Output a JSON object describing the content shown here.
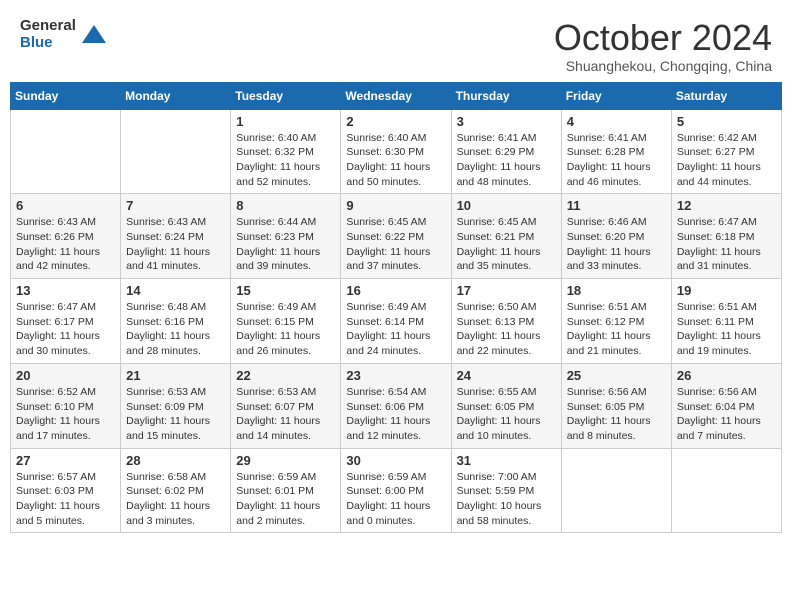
{
  "header": {
    "logo_general": "General",
    "logo_blue": "Blue",
    "month_title": "October 2024",
    "location": "Shuanghekou, Chongqing, China"
  },
  "weekdays": [
    "Sunday",
    "Monday",
    "Tuesday",
    "Wednesday",
    "Thursday",
    "Friday",
    "Saturday"
  ],
  "weeks": [
    [
      {
        "day": "",
        "sunrise": "",
        "sunset": "",
        "daylight": ""
      },
      {
        "day": "",
        "sunrise": "",
        "sunset": "",
        "daylight": ""
      },
      {
        "day": "1",
        "sunrise": "Sunrise: 6:40 AM",
        "sunset": "Sunset: 6:32 PM",
        "daylight": "Daylight: 11 hours and 52 minutes."
      },
      {
        "day": "2",
        "sunrise": "Sunrise: 6:40 AM",
        "sunset": "Sunset: 6:30 PM",
        "daylight": "Daylight: 11 hours and 50 minutes."
      },
      {
        "day": "3",
        "sunrise": "Sunrise: 6:41 AM",
        "sunset": "Sunset: 6:29 PM",
        "daylight": "Daylight: 11 hours and 48 minutes."
      },
      {
        "day": "4",
        "sunrise": "Sunrise: 6:41 AM",
        "sunset": "Sunset: 6:28 PM",
        "daylight": "Daylight: 11 hours and 46 minutes."
      },
      {
        "day": "5",
        "sunrise": "Sunrise: 6:42 AM",
        "sunset": "Sunset: 6:27 PM",
        "daylight": "Daylight: 11 hours and 44 minutes."
      }
    ],
    [
      {
        "day": "6",
        "sunrise": "Sunrise: 6:43 AM",
        "sunset": "Sunset: 6:26 PM",
        "daylight": "Daylight: 11 hours and 42 minutes."
      },
      {
        "day": "7",
        "sunrise": "Sunrise: 6:43 AM",
        "sunset": "Sunset: 6:24 PM",
        "daylight": "Daylight: 11 hours and 41 minutes."
      },
      {
        "day": "8",
        "sunrise": "Sunrise: 6:44 AM",
        "sunset": "Sunset: 6:23 PM",
        "daylight": "Daylight: 11 hours and 39 minutes."
      },
      {
        "day": "9",
        "sunrise": "Sunrise: 6:45 AM",
        "sunset": "Sunset: 6:22 PM",
        "daylight": "Daylight: 11 hours and 37 minutes."
      },
      {
        "day": "10",
        "sunrise": "Sunrise: 6:45 AM",
        "sunset": "Sunset: 6:21 PM",
        "daylight": "Daylight: 11 hours and 35 minutes."
      },
      {
        "day": "11",
        "sunrise": "Sunrise: 6:46 AM",
        "sunset": "Sunset: 6:20 PM",
        "daylight": "Daylight: 11 hours and 33 minutes."
      },
      {
        "day": "12",
        "sunrise": "Sunrise: 6:47 AM",
        "sunset": "Sunset: 6:18 PM",
        "daylight": "Daylight: 11 hours and 31 minutes."
      }
    ],
    [
      {
        "day": "13",
        "sunrise": "Sunrise: 6:47 AM",
        "sunset": "Sunset: 6:17 PM",
        "daylight": "Daylight: 11 hours and 30 minutes."
      },
      {
        "day": "14",
        "sunrise": "Sunrise: 6:48 AM",
        "sunset": "Sunset: 6:16 PM",
        "daylight": "Daylight: 11 hours and 28 minutes."
      },
      {
        "day": "15",
        "sunrise": "Sunrise: 6:49 AM",
        "sunset": "Sunset: 6:15 PM",
        "daylight": "Daylight: 11 hours and 26 minutes."
      },
      {
        "day": "16",
        "sunrise": "Sunrise: 6:49 AM",
        "sunset": "Sunset: 6:14 PM",
        "daylight": "Daylight: 11 hours and 24 minutes."
      },
      {
        "day": "17",
        "sunrise": "Sunrise: 6:50 AM",
        "sunset": "Sunset: 6:13 PM",
        "daylight": "Daylight: 11 hours and 22 minutes."
      },
      {
        "day": "18",
        "sunrise": "Sunrise: 6:51 AM",
        "sunset": "Sunset: 6:12 PM",
        "daylight": "Daylight: 11 hours and 21 minutes."
      },
      {
        "day": "19",
        "sunrise": "Sunrise: 6:51 AM",
        "sunset": "Sunset: 6:11 PM",
        "daylight": "Daylight: 11 hours and 19 minutes."
      }
    ],
    [
      {
        "day": "20",
        "sunrise": "Sunrise: 6:52 AM",
        "sunset": "Sunset: 6:10 PM",
        "daylight": "Daylight: 11 hours and 17 minutes."
      },
      {
        "day": "21",
        "sunrise": "Sunrise: 6:53 AM",
        "sunset": "Sunset: 6:09 PM",
        "daylight": "Daylight: 11 hours and 15 minutes."
      },
      {
        "day": "22",
        "sunrise": "Sunrise: 6:53 AM",
        "sunset": "Sunset: 6:07 PM",
        "daylight": "Daylight: 11 hours and 14 minutes."
      },
      {
        "day": "23",
        "sunrise": "Sunrise: 6:54 AM",
        "sunset": "Sunset: 6:06 PM",
        "daylight": "Daylight: 11 hours and 12 minutes."
      },
      {
        "day": "24",
        "sunrise": "Sunrise: 6:55 AM",
        "sunset": "Sunset: 6:05 PM",
        "daylight": "Daylight: 11 hours and 10 minutes."
      },
      {
        "day": "25",
        "sunrise": "Sunrise: 6:56 AM",
        "sunset": "Sunset: 6:05 PM",
        "daylight": "Daylight: 11 hours and 8 minutes."
      },
      {
        "day": "26",
        "sunrise": "Sunrise: 6:56 AM",
        "sunset": "Sunset: 6:04 PM",
        "daylight": "Daylight: 11 hours and 7 minutes."
      }
    ],
    [
      {
        "day": "27",
        "sunrise": "Sunrise: 6:57 AM",
        "sunset": "Sunset: 6:03 PM",
        "daylight": "Daylight: 11 hours and 5 minutes."
      },
      {
        "day": "28",
        "sunrise": "Sunrise: 6:58 AM",
        "sunset": "Sunset: 6:02 PM",
        "daylight": "Daylight: 11 hours and 3 minutes."
      },
      {
        "day": "29",
        "sunrise": "Sunrise: 6:59 AM",
        "sunset": "Sunset: 6:01 PM",
        "daylight": "Daylight: 11 hours and 2 minutes."
      },
      {
        "day": "30",
        "sunrise": "Sunrise: 6:59 AM",
        "sunset": "Sunset: 6:00 PM",
        "daylight": "Daylight: 11 hours and 0 minutes."
      },
      {
        "day": "31",
        "sunrise": "Sunrise: 7:00 AM",
        "sunset": "Sunset: 5:59 PM",
        "daylight": "Daylight: 10 hours and 58 minutes."
      },
      {
        "day": "",
        "sunrise": "",
        "sunset": "",
        "daylight": ""
      },
      {
        "day": "",
        "sunrise": "",
        "sunset": "",
        "daylight": ""
      }
    ]
  ]
}
